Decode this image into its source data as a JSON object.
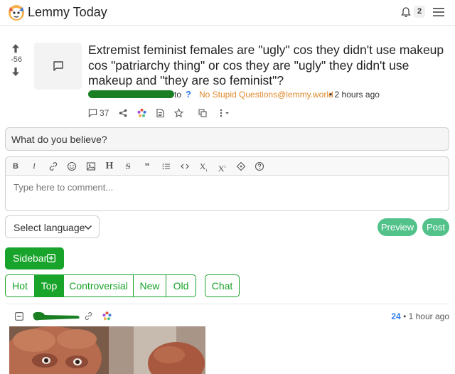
{
  "navbar": {
    "brand": "Lemmy Today",
    "notification_count": "2"
  },
  "post": {
    "score": "-56",
    "title": "Extremist feminist females are \"ugly\" cos they didn't use makeup cos \"patriarchy thing\" or cos they are \"ugly\" they didn't use makeup and \"they are so feminist\"?",
    "to_label": "to",
    "community": "No Stupid Questions@lemmy.world",
    "time": "• 2 hours ago",
    "comment_count": "37"
  },
  "belief_prompt": "What do you believe?",
  "editor": {
    "toolbar": [
      "B",
      "I",
      "link",
      "emoji",
      "image",
      "H",
      "S",
      "quote",
      "list",
      "code",
      "subscript",
      "superscript",
      "spoiler",
      "help"
    ],
    "placeholder": "Type here to comment..."
  },
  "language_select": "Select language",
  "buttons": {
    "preview": "Preview",
    "post": "Post",
    "sidebar": "Sidebar"
  },
  "sort": {
    "options": [
      "Hot",
      "Top",
      "Controversial",
      "New",
      "Old"
    ],
    "active": "Top",
    "chat": "Chat"
  },
  "comment": {
    "score": "24",
    "time": "• 1 hour ago"
  },
  "colors": {
    "primary_green": "#18a32a",
    "pill_green": "#52c28a",
    "community_orange": "#e08a2d",
    "link_blue": "#2b7de9"
  }
}
